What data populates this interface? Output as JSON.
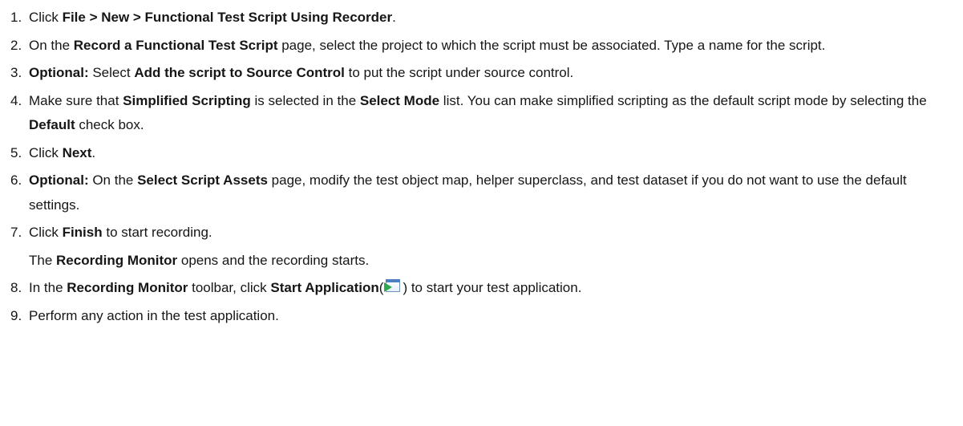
{
  "steps": [
    {
      "num": "1.",
      "parts": [
        {
          "t": "Click ",
          "b": false
        },
        {
          "t": "File > New  > Functional Test Script Using Recorder",
          "b": true
        },
        {
          "t": ".",
          "b": false
        }
      ]
    },
    {
      "num": "2.",
      "parts": [
        {
          "t": "On the ",
          "b": false
        },
        {
          "t": "Record a Functional Test Script",
          "b": true
        },
        {
          "t": "  page, select the project to which the script must be associated. Type a name for the script.",
          "b": false
        }
      ]
    },
    {
      "num": "3.",
      "parts": [
        {
          "t": "Optional:",
          "b": true
        },
        {
          "t": " Select ",
          "b": false
        },
        {
          "t": "Add the script to Source Control",
          "b": true
        },
        {
          "t": " to put the script under source control.",
          "b": false
        }
      ]
    },
    {
      "num": "4.",
      "parts": [
        {
          "t": "Make sure that ",
          "b": false
        },
        {
          "t": "Simplified Scripting",
          "b": true
        },
        {
          "t": " is selected in the ",
          "b": false
        },
        {
          "t": "Select Mode",
          "b": true
        },
        {
          "t": " list. You can make simplified scripting as the default script mode by selecting the ",
          "b": false
        },
        {
          "t": "Default",
          "b": true
        },
        {
          "t": " check box.",
          "b": false
        }
      ]
    },
    {
      "num": "5.",
      "parts": [
        {
          "t": "Click ",
          "b": false
        },
        {
          "t": "Next",
          "b": true
        },
        {
          "t": ".",
          "b": false
        }
      ]
    },
    {
      "num": "6.",
      "parts": [
        {
          "t": "Optional:",
          "b": true
        },
        {
          "t": " On the ",
          "b": false
        },
        {
          "t": "Select Script Assets",
          "b": true
        },
        {
          "t": " page, modify the test object map, helper superclass, and test dataset if you do not want to use the default settings.",
          "b": false
        }
      ]
    },
    {
      "num": "7.",
      "parts": [
        {
          "t": "Click ",
          "b": false
        },
        {
          "t": "Finish",
          "b": true
        },
        {
          "t": " to start recording.",
          "b": false
        }
      ],
      "sub": [
        {
          "t": "The ",
          "b": false
        },
        {
          "t": "Recording Monitor",
          "b": true
        },
        {
          "t": " opens and the recording starts.",
          "b": false
        }
      ]
    },
    {
      "num": "8.",
      "parts": [
        {
          "t": "In the ",
          "b": false
        },
        {
          "t": "Recording Monitor",
          "b": true
        },
        {
          "t": " toolbar, click ",
          "b": false
        },
        {
          "t": "Start Application",
          "b": true
        },
        {
          "t": "(",
          "b": false
        },
        {
          "icon": "start-application-icon"
        },
        {
          "t": ") to start your test application.",
          "b": false
        }
      ]
    },
    {
      "num": "9.",
      "parts": [
        {
          "t": "Perform any action in the test application.",
          "b": false
        }
      ]
    }
  ]
}
